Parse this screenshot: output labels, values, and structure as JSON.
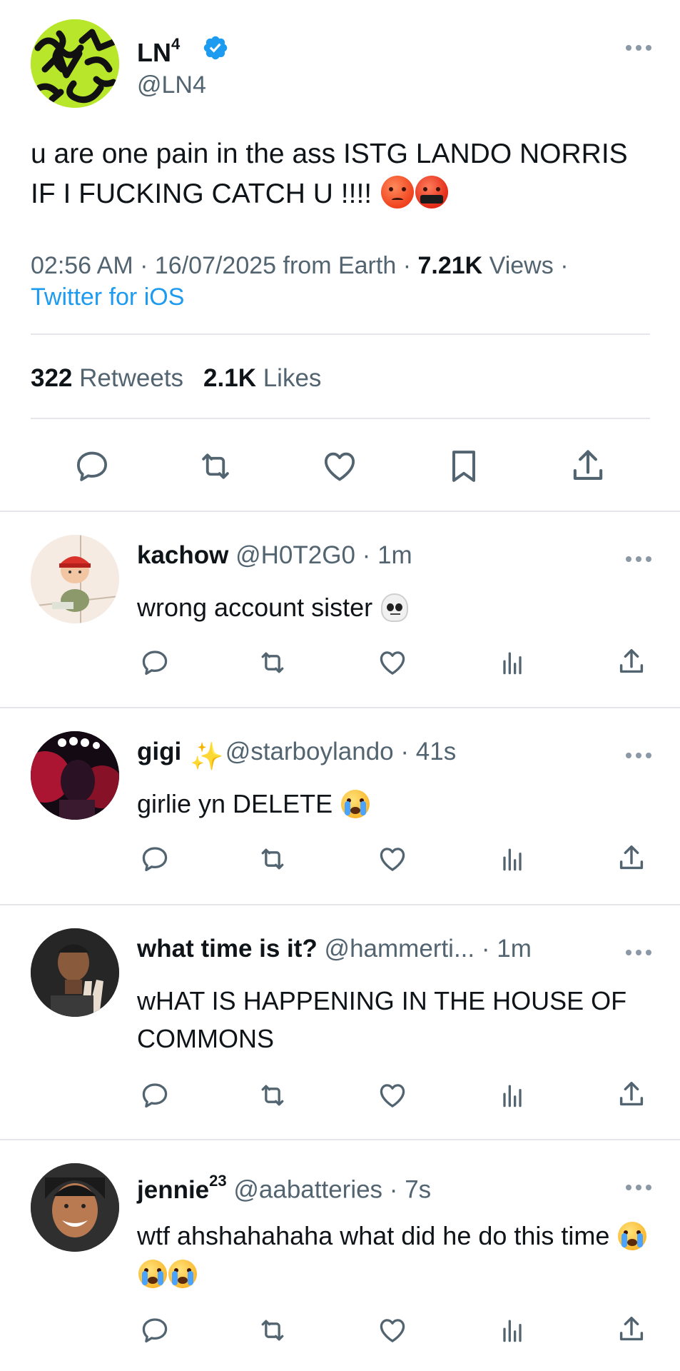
{
  "main_tweet": {
    "display_name": "LN",
    "display_name_sup": "4",
    "handle": "@LN4",
    "text": "u are one pain in the ass ISTG LANDO NORRIS IF I FUCKING CATCH U !!!!",
    "time": "02:56 AM",
    "date": "16/07/2025",
    "location_text": "from Earth",
    "views_count": "7.21K",
    "views_label": "Views",
    "source": "Twitter for iOS",
    "retweets_count": "322",
    "retweets_label": "Retweets",
    "likes_count": "2.1K",
    "likes_label": "Likes",
    "avatar_color": "#b8e62b",
    "verified_color": "#1d9bf0"
  },
  "replies": [
    {
      "name": "kachow",
      "handle": "@H0T2G0",
      "time": "1m",
      "text": "wrong account sister",
      "emoji": "skull-emoji"
    },
    {
      "name": "gigi",
      "handle": "@starboylando",
      "time": "41s",
      "text": "girlie yn DELETE",
      "emoji": "loudly-crying-emoji"
    },
    {
      "name": "what time is it?",
      "handle": "@hammerti...",
      "time": "1m",
      "text": "wHAT IS HAPPENING IN THE HOUSE OF COMMONS"
    },
    {
      "name": "jennie",
      "name_sup": "23",
      "handle": "@aabatteries",
      "time": "7s",
      "text": "wtf ahshahahaha what did he do this time",
      "emoji": "loudly-crying-emoji"
    }
  ],
  "colors": {
    "text_primary": "#0f1419",
    "text_secondary": "#536471",
    "link": "#1d9bf0",
    "divider": "#e4e6e9",
    "icon": "#536471"
  },
  "separators": {
    "dot": "·"
  },
  "icons": [
    "reply-icon",
    "retweet-icon",
    "like-icon",
    "bookmark-icon",
    "share-icon",
    "views-icon",
    "more-icon",
    "verified-icon"
  ]
}
